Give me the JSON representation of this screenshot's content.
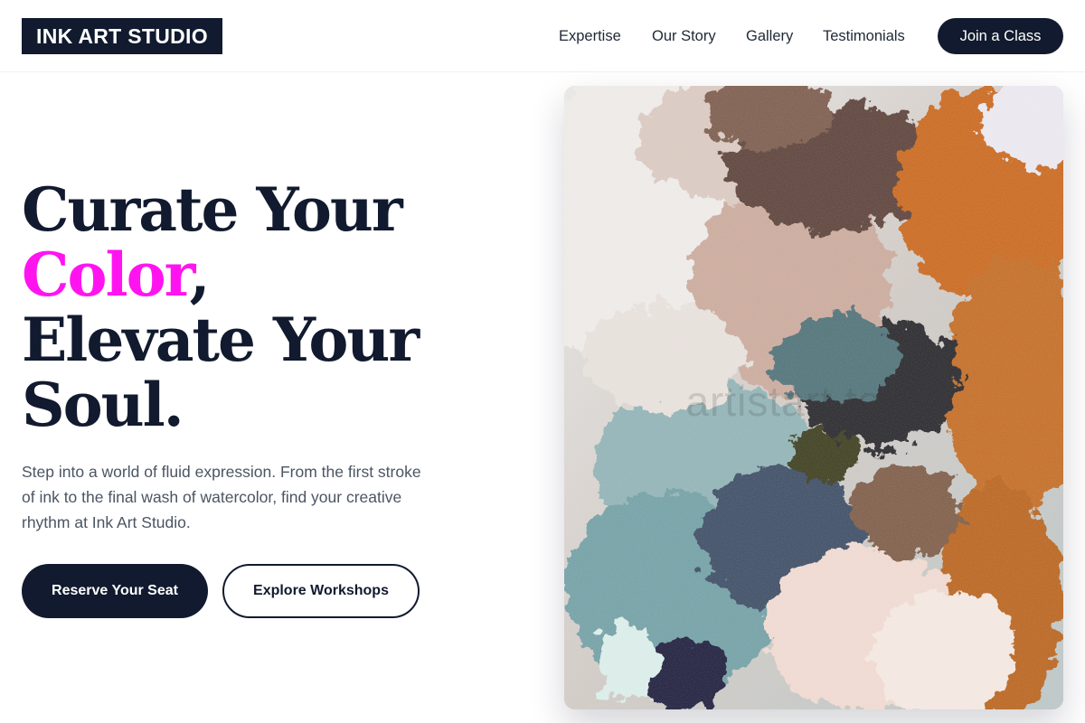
{
  "header": {
    "logo": "INK ART STUDIO",
    "nav": [
      "Expertise",
      "Our Story",
      "Gallery",
      "Testimonials"
    ],
    "cta": "Join a Class"
  },
  "hero": {
    "line1": "Curate Your",
    "accent_word": "Color",
    "accent_suffix": ",",
    "line3": "Elevate Your",
    "line4": "Soul.",
    "description": "Step into a world of fluid expression. From the first stroke of ink to the final wash of watercolor, find your creative rhythm at Ink Art Studio.",
    "primary_button": "Reserve Your Seat",
    "secondary_button": "Explore Workshops"
  },
  "image": {
    "icon": "abstract-impasto-painting",
    "watermark": "artistart.tokyo"
  },
  "colors": {
    "brand_dark": "#111a2e",
    "accent": "#ff14f0",
    "body_text": "#4b5563",
    "background": "#ffffff"
  }
}
